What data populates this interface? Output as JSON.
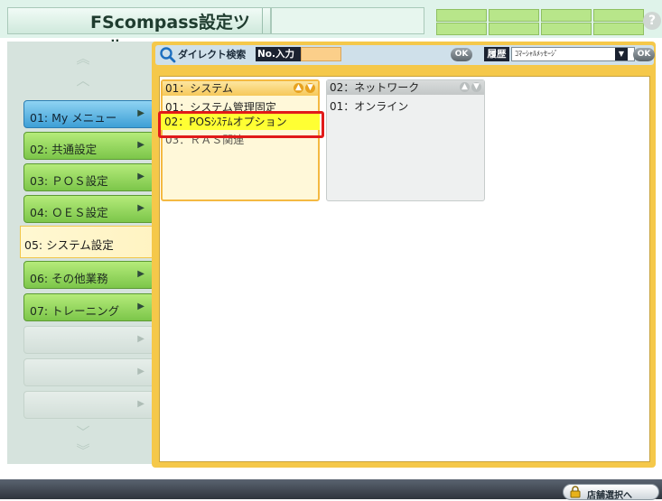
{
  "app": {
    "title": "FScompass設定ツール",
    "help_icon": "?"
  },
  "search": {
    "label": "ダイレクト検索",
    "no_input_label": "No.入力",
    "no_input_value": "",
    "ok_label": "OK",
    "history_label": "履歴",
    "history_selected": "ｺﾏｰｼｬﾙﾒｯｾｰｼﾞ",
    "history_ok_label": "OK"
  },
  "nav": {
    "items": [
      {
        "label": "01: My メニュー",
        "style": "blue"
      },
      {
        "label": "02: 共通設定",
        "style": "green"
      },
      {
        "label": "03: ＰＯＳ設定",
        "style": "green"
      },
      {
        "label": "04: ＯＥＳ設定",
        "style": "green"
      },
      {
        "label": "05: システム設定",
        "style": "selected"
      },
      {
        "label": "06: その他業務",
        "style": "green"
      },
      {
        "label": "07: トレーニング",
        "style": "green"
      }
    ]
  },
  "columns": [
    {
      "header": "01：システム",
      "items": [
        "01：システム管理固定",
        "02：POSｼｽﾃﾑオプション",
        "03：ＲＡＳ関連"
      ]
    },
    {
      "header": "02：ネットワーク",
      "items": [
        "01：オンライン"
      ]
    }
  ],
  "bottom": {
    "store_button_label": "店舗選択へ"
  },
  "colors": {
    "accent_yellow": "#f5c84a",
    "highlight_red": "#e11a1a",
    "selected_item": "#ffff33",
    "nav_green": "#7cc64a",
    "nav_blue": "#3d9fd6"
  }
}
